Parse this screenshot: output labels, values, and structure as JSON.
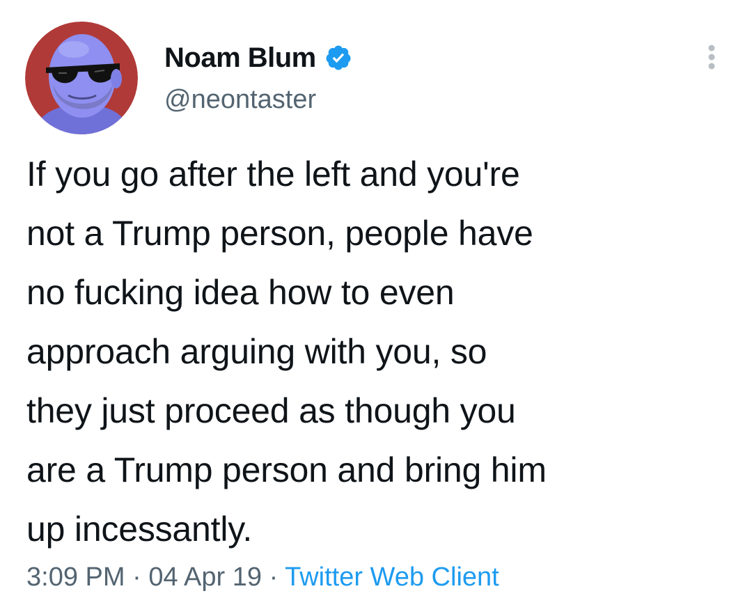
{
  "author": {
    "display_name": "Noam Blum",
    "handle": "@neontaster",
    "verified": true,
    "avatar_colors": {
      "background": "#b03a38",
      "face": "#8e8ff0",
      "sunglasses": "#111111",
      "beard": "#7a7ac8"
    }
  },
  "tweet": {
    "text": "If you go after the left and you're\nnot a Trump person, people have\nno fucking idea how to even\napproach arguing with you, so\nthey just proceed as though you\nare a Trump person and bring him\nup incessantly."
  },
  "meta": {
    "time": "3:09 PM",
    "separator": "·",
    "date": "04 Apr 19",
    "source": "Twitter Web Client"
  },
  "icons": {
    "verified": "verified-badge-icon",
    "more": "more-options-icon"
  },
  "colors": {
    "text": "#0f1419",
    "secondary": "#536471",
    "accent": "#1d9bf0"
  }
}
